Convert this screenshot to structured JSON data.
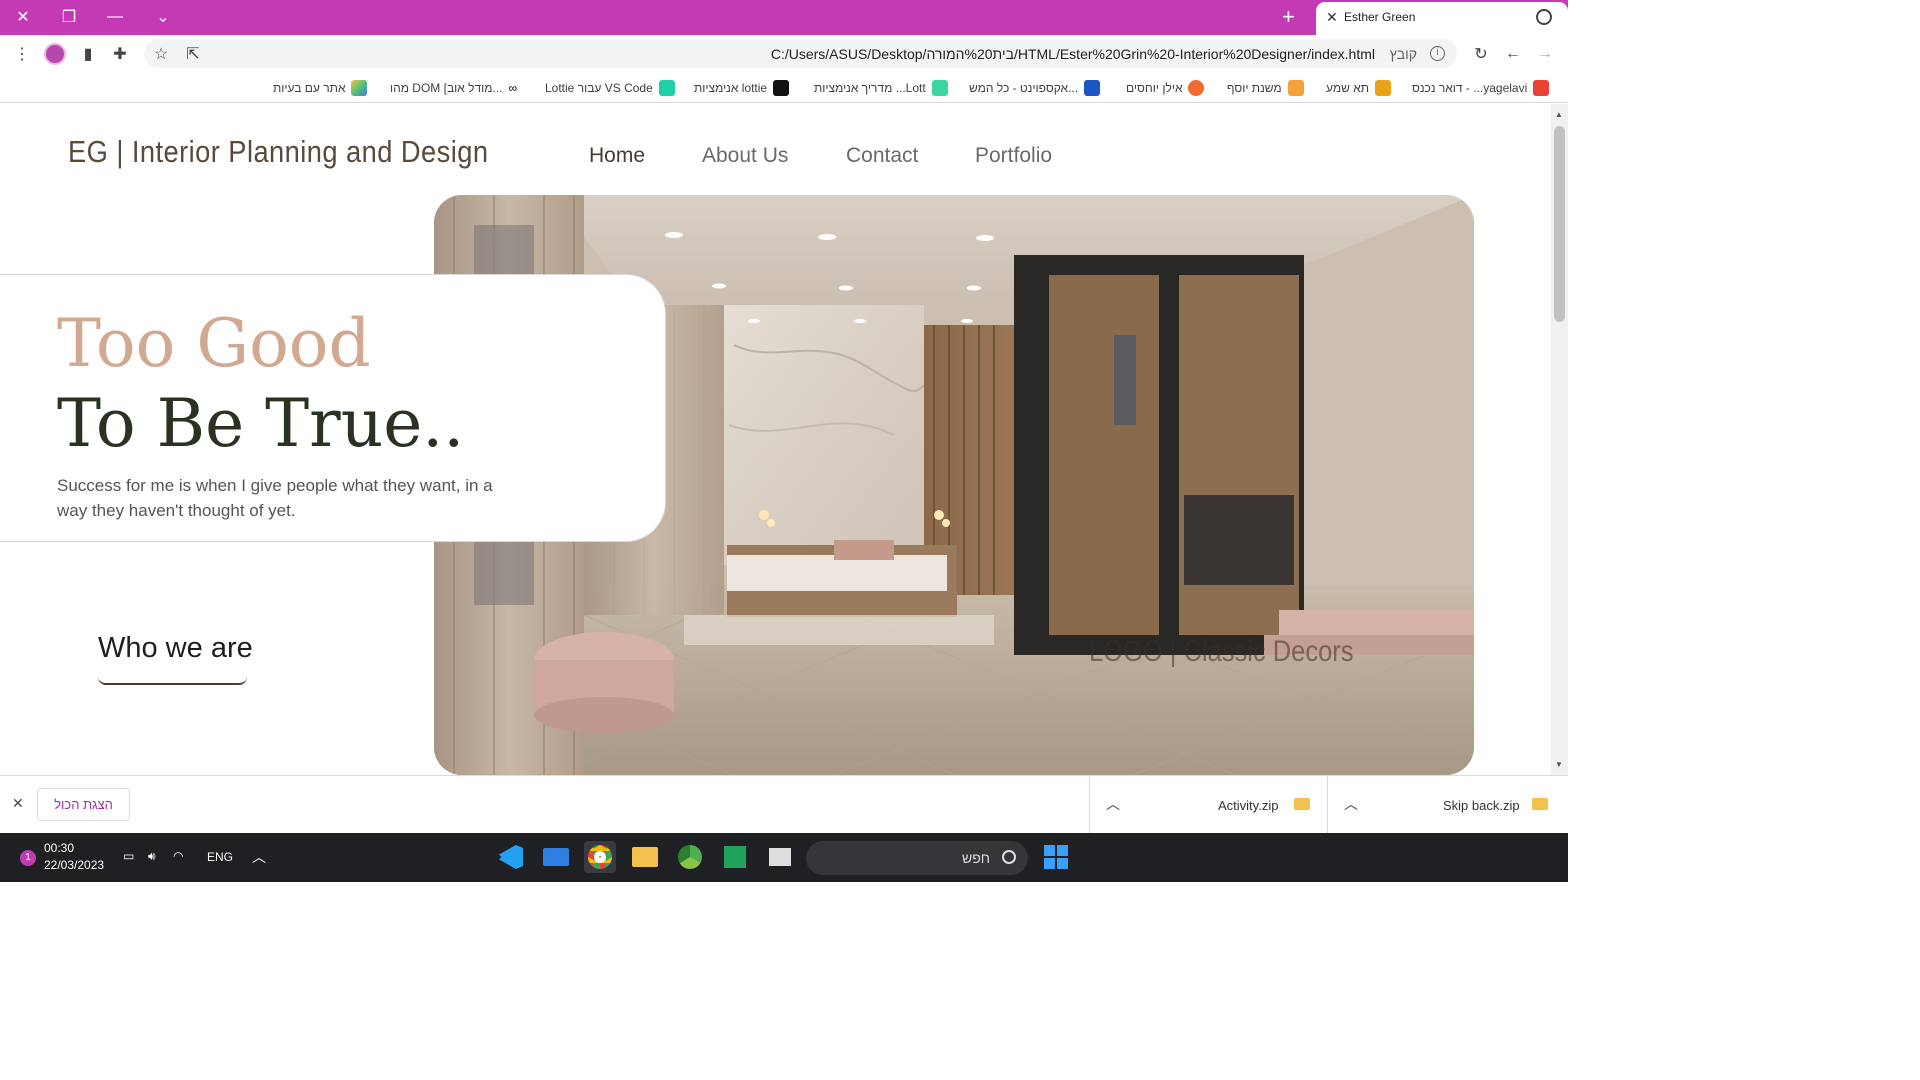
{
  "browser": {
    "tab_title": "Esther Green",
    "url": "C:/Users/ASUS/Desktop/בית%20המורה/HTML/Ester%20Grin%20-Interior%20Designer/index.html",
    "file_label": "קובץ",
    "accent_color": "#c43ab5",
    "bookmarks": [
      "דואר נכנס - ...yagelavi",
      "תא שמע",
      "משנת יוסף",
      "אילן יוחסים",
      "אקספוינט - כל המש...",
      "מדריך אנימציות ...Lott",
      "אנימציות lottie",
      "Lottie עבור VS Code",
      "מהו DOM [מודל אוב...",
      "אתר עם בעיות"
    ]
  },
  "site": {
    "logo": "EG | Interior Planning and Design",
    "nav": [
      "Home",
      "About Us",
      "Contact",
      "Portfolio"
    ],
    "hero_title_line1": "Too Good",
    "hero_title_line2": "To Be True..",
    "tagline": "Success for me is when I give people what they want, in a way they haven't thought of yet.",
    "who_we_are": "Who we are",
    "hero_image_caption": "LOGO | Classic Decors",
    "colors": {
      "accent_rose": "#d2a990",
      "dark_green": "#2a3322",
      "brown": "#4a3b30"
    }
  },
  "downloads": {
    "show_all": "הצגת הכול",
    "items": [
      "Activity.zip",
      "Skip back.zip"
    ]
  },
  "taskbar": {
    "time": "00:30",
    "date": "22/03/2023",
    "language": "ENG",
    "notification_count": "1",
    "search_label": "חפש"
  }
}
